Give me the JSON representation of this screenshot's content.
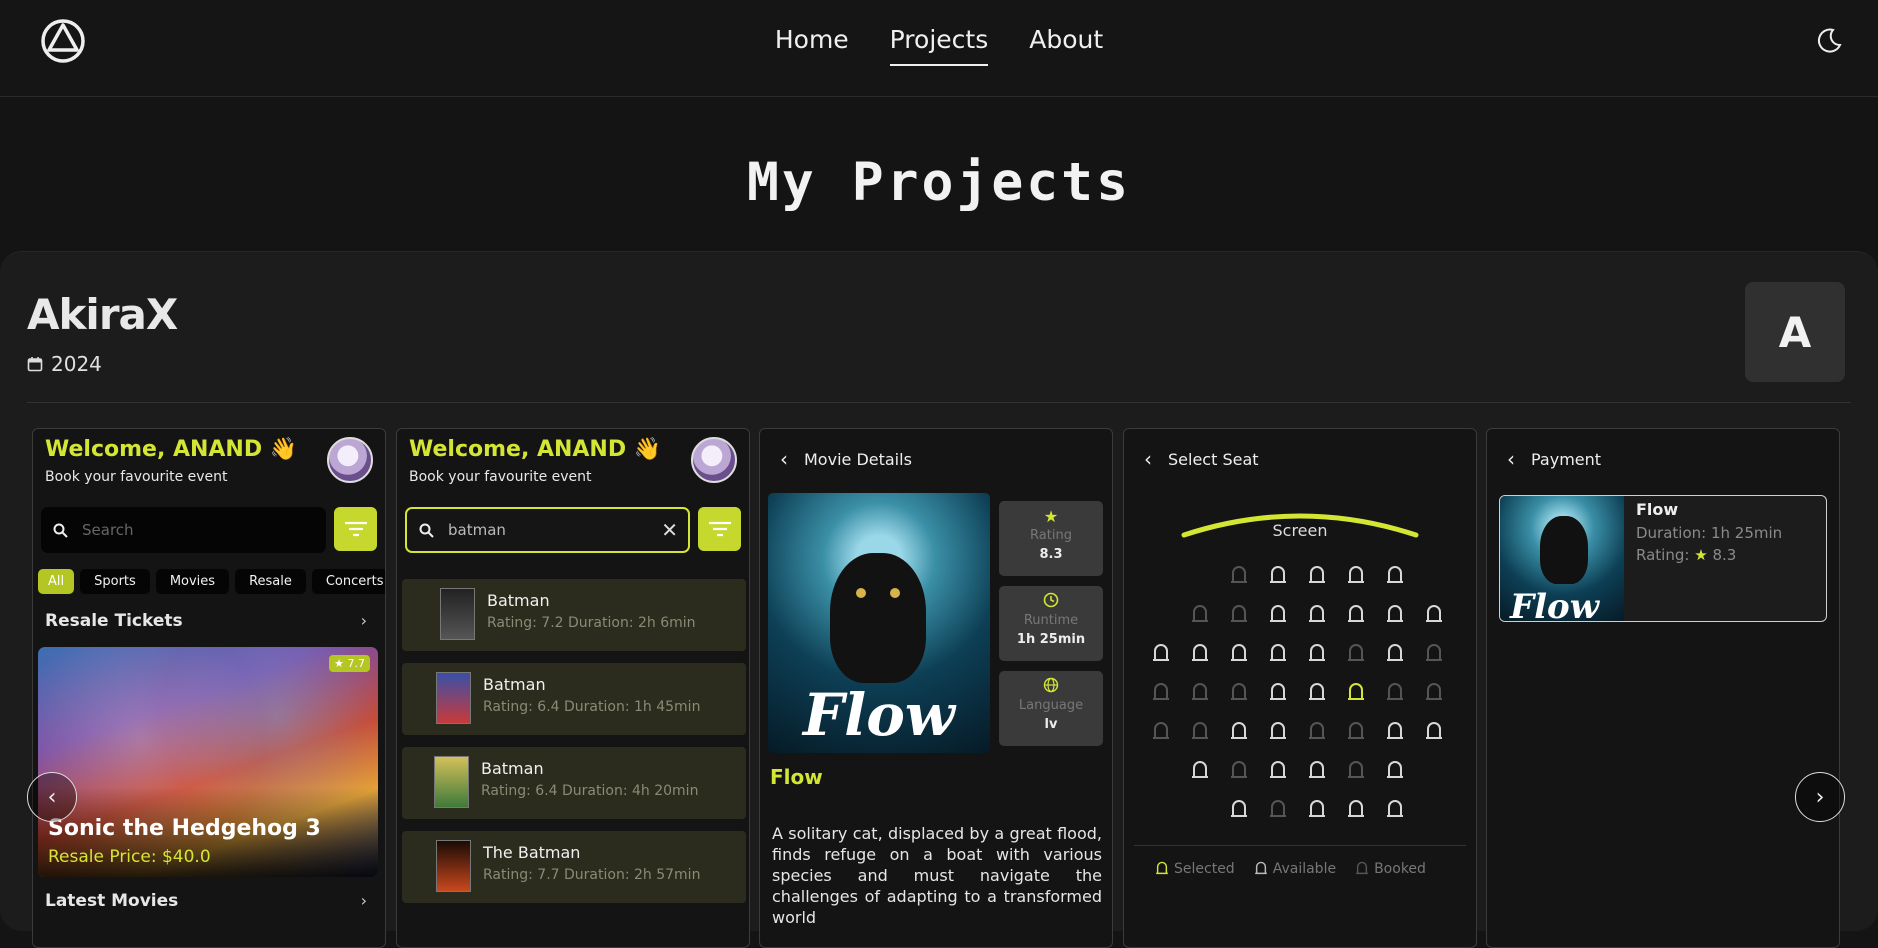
{
  "nav": {
    "items": [
      "Home",
      "Projects",
      "About"
    ],
    "active": "Projects"
  },
  "page": {
    "title": "My Projects"
  },
  "project": {
    "name": "AkiraX",
    "year": "2024",
    "avatar_letter": "A"
  },
  "home_screen": {
    "welcome": "Welcome, ANAND 👋",
    "subtitle": "Book your favourite event",
    "search_placeholder": "Search",
    "categories": [
      "All",
      "Sports",
      "Movies",
      "Resale",
      "Concerts"
    ],
    "resale_heading": "Resale Tickets",
    "featured": {
      "title": "Sonic the Hedgehog 3",
      "price": "Resale Price: $40.0",
      "rating": "★ 7.7"
    },
    "latest_heading": "Latest Movies"
  },
  "search_screen": {
    "welcome": "Welcome, ANAND 👋",
    "subtitle": "Book your favourite event",
    "query": "batman",
    "results": [
      {
        "title": "Batman",
        "meta": "Rating: 7.2 Duration: 2h 6min"
      },
      {
        "title": "Batman",
        "meta": "Rating: 6.4 Duration: 1h 45min"
      },
      {
        "title": "Batman",
        "meta": "Rating: 6.4 Duration: 4h 20min"
      },
      {
        "title": "The Batman",
        "meta": "Rating: 7.7 Duration: 2h 57min"
      }
    ]
  },
  "details_screen": {
    "header": "Movie Details",
    "poster_title": "Flow",
    "tiles": [
      {
        "label": "Rating",
        "value": "8.3",
        "icon": "star-icon"
      },
      {
        "label": "Runtime",
        "value": "1h 25min",
        "icon": "clock-icon"
      },
      {
        "label": "Language",
        "value": "lv",
        "icon": "globe-icon"
      }
    ],
    "movie_name": "Flow",
    "synopsis": "A solitary cat, displaced by a great flood, finds refuge on a boat with various species and must navigate the challenges of adapting to a transformed world"
  },
  "seat_screen": {
    "header": "Select Seat",
    "screen_label": "Screen",
    "legend": [
      "Selected",
      "Available",
      "Booked"
    ]
  },
  "payment_screen": {
    "header": "Payment",
    "title": "Flow",
    "duration": "Duration: 1h 25min",
    "rating_label": "Rating:",
    "rating_value": "8.3",
    "poster_title": "Flow"
  },
  "colors": {
    "accent": "#d4e634",
    "background": "#141414",
    "card": "#1c1c1c"
  }
}
